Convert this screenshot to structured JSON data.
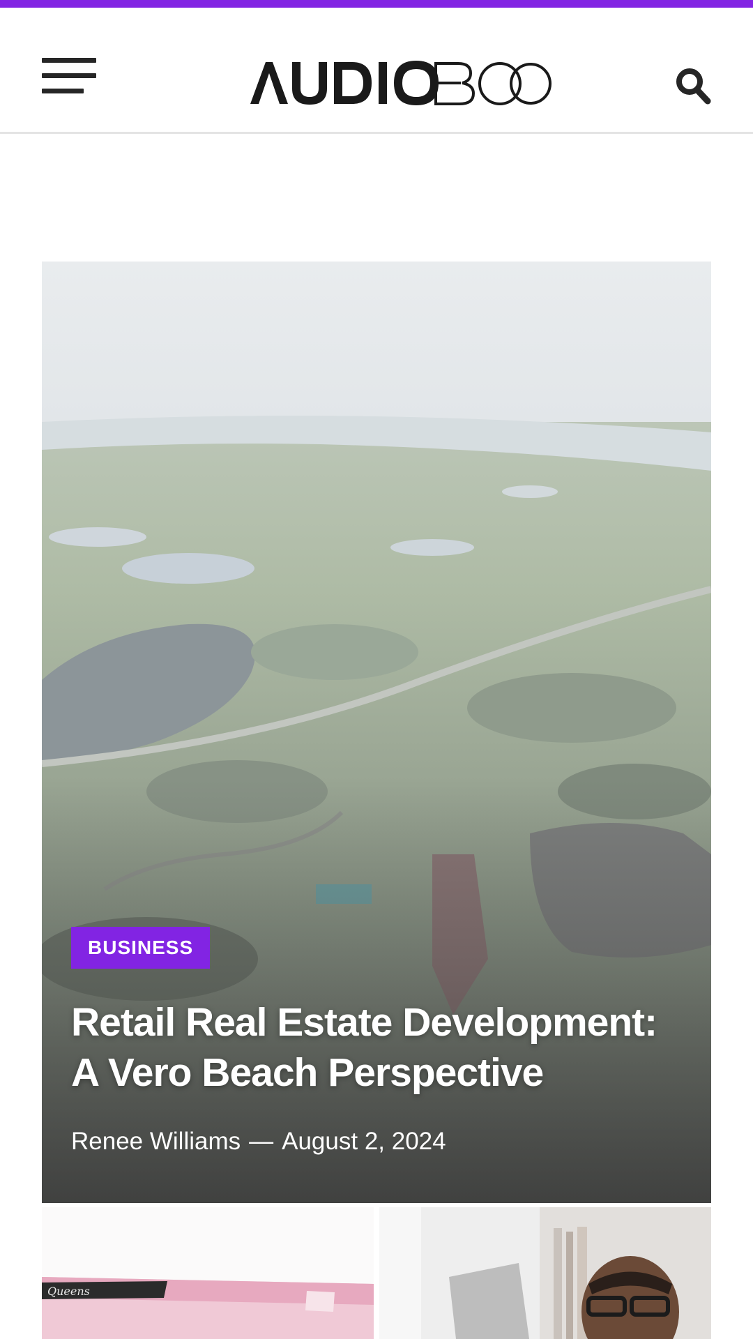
{
  "colors": {
    "accent": "#8224e3",
    "header_border": "#e4e4e4",
    "icon": "#262626"
  },
  "header": {
    "menu_icon": "hamburger-menu-icon",
    "logo_text": "AUDIOBOO",
    "search_icon": "search-icon"
  },
  "hero": {
    "category": "BUSINESS",
    "title": "Retail Real Estate Development: A Vero Beach Perspective",
    "author": "Renee Williams",
    "separator": "—",
    "date": "August 2, 2024"
  },
  "cards": [
    {
      "image_label": "Queens"
    },
    {
      "image_label": ""
    }
  ]
}
